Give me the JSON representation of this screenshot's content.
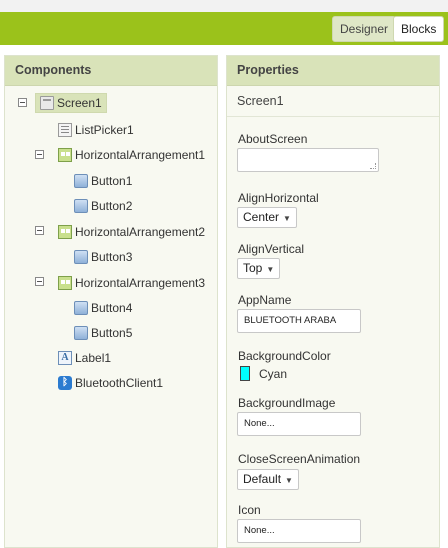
{
  "toolbar": {
    "designer_label": "Designer",
    "blocks_label": "Blocks"
  },
  "components_panel": {
    "title": "Components",
    "tree": [
      {
        "label": "Screen1",
        "icon": "screen-icon",
        "selected": true
      },
      {
        "label": "ListPicker1",
        "icon": "listpicker-icon"
      },
      {
        "label": "HorizontalArrangement1",
        "icon": "horizontal-arrangement-icon"
      },
      {
        "label": "Button1",
        "icon": "button-icon"
      },
      {
        "label": "Button2",
        "icon": "button-icon"
      },
      {
        "label": "HorizontalArrangement2",
        "icon": "horizontal-arrangement-icon"
      },
      {
        "label": "Button3",
        "icon": "button-icon"
      },
      {
        "label": "HorizontalArrangement3",
        "icon": "horizontal-arrangement-icon"
      },
      {
        "label": "Button4",
        "icon": "button-icon"
      },
      {
        "label": "Button5",
        "icon": "button-icon"
      },
      {
        "label": "Label1",
        "icon": "label-icon"
      },
      {
        "label": "BluetoothClient1",
        "icon": "bluetooth-icon"
      }
    ]
  },
  "properties_panel": {
    "title": "Properties",
    "component": "Screen1",
    "about_screen": {
      "label": "AboutScreen",
      "value": ""
    },
    "align_horizontal": {
      "label": "AlignHorizontal",
      "value": "Center"
    },
    "align_vertical": {
      "label": "AlignVertical",
      "value": "Top"
    },
    "app_name": {
      "label": "AppName",
      "value": "BLUETOOTH ARABA"
    },
    "background_color": {
      "label": "BackgroundColor",
      "value": "Cyan",
      "swatch": "#00ffff"
    },
    "background_image": {
      "label": "BackgroundImage",
      "value": "None..."
    },
    "close_screen_animation": {
      "label": "CloseScreenAnimation",
      "value": "Default"
    },
    "icon": {
      "label": "Icon",
      "value": "None..."
    }
  },
  "colors": {
    "accent_green": "#9bc21b",
    "panel_header": "#d9e3b9"
  }
}
